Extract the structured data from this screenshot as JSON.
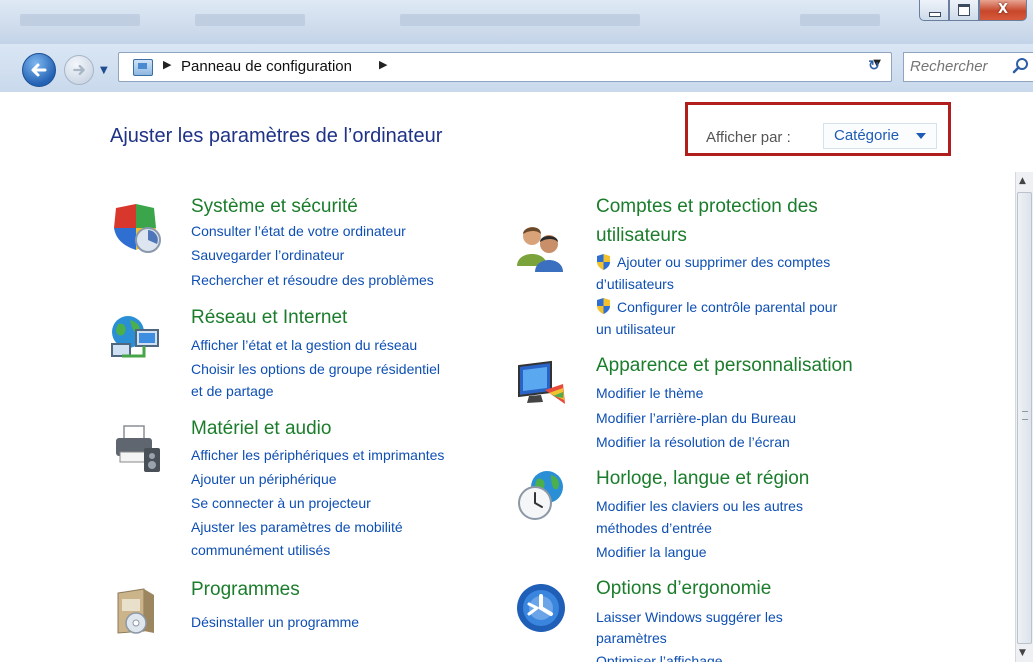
{
  "window": {
    "controls": {
      "minimize_icon": "minimize-icon",
      "maximize_icon": "maximize-icon",
      "close_label": "X"
    }
  },
  "navbar": {
    "breadcrumb": [
      "Panneau de configuration"
    ],
    "search_placeholder": "Rechercher"
  },
  "content": {
    "title": "Ajuster les paramètres de l’ordinateur",
    "view_by_label": "Afficher par :",
    "view_by_value": "Catégorie",
    "categories": [
      {
        "title": "Système et sécurité",
        "icon": "security-shield-icon",
        "links": [
          "Consulter l’état de votre ordinateur",
          "Sauvegarder l’ordinateur",
          "Rechercher et résoudre des problèmes"
        ]
      },
      {
        "title": "Réseau et Internet",
        "icon": "network-globe-icon",
        "links": [
          "Afficher l’état et la gestion du réseau",
          "Choisir les options de groupe résidentiel",
          "et de partage"
        ]
      },
      {
        "title": "Matériel et audio",
        "icon": "printer-icon",
        "links": [
          "Afficher les périphériques et imprimantes",
          "Ajouter un périphérique",
          "Se connecter à un projecteur",
          "Ajuster les paramètres de mobilité",
          "communément utilisés"
        ]
      },
      {
        "title": "Programmes",
        "icon": "programs-box-icon",
        "links": [
          "Désinstaller un programme"
        ]
      },
      {
        "title_line1": "Comptes et protection des",
        "title_line2": "utilisateurs",
        "icon": "users-icon",
        "links": [
          "Ajouter ou supprimer des comptes",
          "d’utilisateurs",
          "Configurer le contrôle parental pour",
          "un utilisateur"
        ]
      },
      {
        "title": "Apparence et personnalisation",
        "icon": "monitor-palette-icon",
        "links": [
          "Modifier le thème",
          "Modifier l’arrière-plan du Bureau",
          "Modifier la résolution de l’écran"
        ]
      },
      {
        "title": "Horloge, langue et région",
        "icon": "clock-globe-icon",
        "links": [
          "Modifier les claviers ou les autres",
          "méthodes d’entrée",
          "Modifier la langue"
        ]
      },
      {
        "title": "Options d’ergonomie",
        "icon": "ease-of-access-icon",
        "links": [
          "Laisser Windows suggérer les",
          "paramètres",
          "Optimiser l’affichage"
        ]
      }
    ]
  },
  "colors": {
    "category_title": "#1b7d2c",
    "link": "#0e4fb3",
    "page_title": "#1e3287",
    "highlight_border": "#b01e1e"
  }
}
